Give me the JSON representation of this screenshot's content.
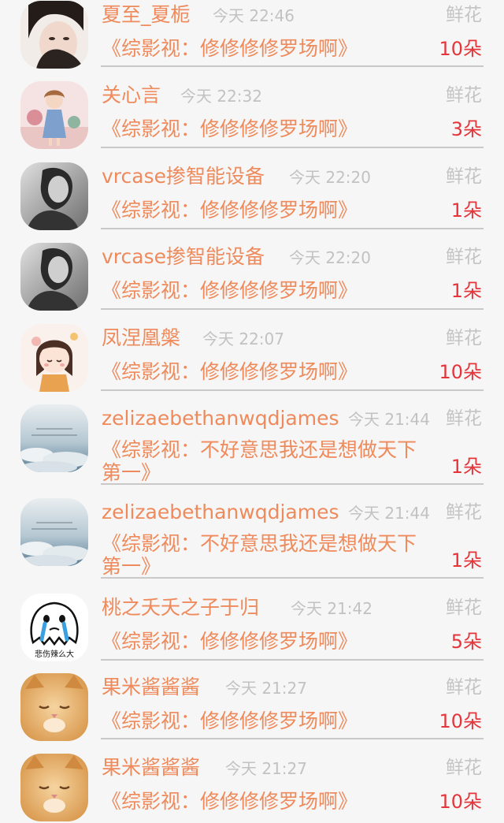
{
  "gift_list": [
    {
      "name": "夏至_夏栀",
      "time": "今天 22:46",
      "gift_type": "鲜花",
      "book": "《综影视：修修修修罗场啊》",
      "count": "10朵",
      "avatar": "portrait-icon"
    },
    {
      "name": "关心言",
      "time": "今天 22:32",
      "gift_type": "鲜花",
      "book": "《综影视：修修修修罗场啊》",
      "count": "3朵",
      "avatar": "illustrated-girl-icon"
    },
    {
      "name": "vrcase掺智能设备",
      "time": "今天 22:20",
      "gift_type": "鲜花",
      "book": "《综影视：修修修修罗场啊》",
      "count": "1朵",
      "avatar": "monochrome-portrait-icon"
    },
    {
      "name": "vrcase掺智能设备",
      "time": "今天 22:20",
      "gift_type": "鲜花",
      "book": "《综影视：修修修修罗场啊》",
      "count": "1朵",
      "avatar": "monochrome-portrait-icon"
    },
    {
      "name": "凤涅凰槃",
      "time": "今天 22:07",
      "gift_type": "鲜花",
      "book": "《综影视：修修修修罗场啊》",
      "count": "10朵",
      "avatar": "cartoon-girl-icon"
    },
    {
      "name": "zelizaebethanwqdjames",
      "time": "今天 21:44",
      "gift_type": "鲜花",
      "book": "《综影视：不好意思我还是想做天下第一》",
      "count": "1朵",
      "avatar": "sky-clouds-icon"
    },
    {
      "name": "zelizaebethanwqdjames",
      "time": "今天 21:44",
      "gift_type": "鲜花",
      "book": "《综影视：不好意思我还是想做天下第一》",
      "count": "1朵",
      "avatar": "sky-clouds-icon"
    },
    {
      "name": "桃之夭夭之子于归",
      "time": "今天 21:42",
      "gift_type": "鲜花",
      "book": "《综影视：修修修修罗场啊》",
      "count": "5朵",
      "avatar": "crying-ghost-icon",
      "avatar_caption": "悲伤辣么大"
    },
    {
      "name": "果米酱酱酱",
      "time": "今天 21:27",
      "gift_type": "鲜花",
      "book": "《综影视：修修修修罗场啊》",
      "count": "10朵",
      "avatar": "kitten-icon"
    },
    {
      "name": "果米酱酱酱",
      "time": "今天 21:27",
      "gift_type": "鲜花",
      "book": "《综影视：修修修修罗场啊》",
      "count": "10朵",
      "avatar": "kitten-icon"
    }
  ],
  "colors": {
    "name_and_book": "#ee8a5b",
    "count": "#e4353a",
    "muted_text": "#c2c2c2",
    "divider": "#c9c9c9",
    "background": "#f7f6f6"
  }
}
